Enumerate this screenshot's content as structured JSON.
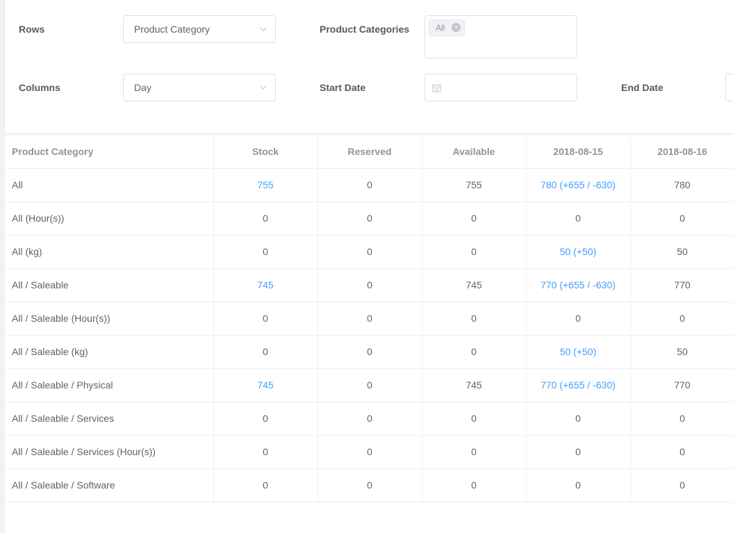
{
  "filters": {
    "rows_label": "Rows",
    "rows_value": "Product Category",
    "columns_label": "Columns",
    "columns_value": "Day",
    "categories_label": "Product Categories",
    "categories_tag": "All",
    "start_date_label": "Start Date",
    "start_date_value": "",
    "end_date_label": "End Date"
  },
  "table": {
    "headers": [
      "Product Category",
      "Stock",
      "Reserved",
      "Available",
      "2018-08-15",
      "2018-08-16"
    ],
    "rows": [
      {
        "cells": [
          "All",
          "755",
          "0",
          "755",
          "780 (+655 / -630)",
          "780"
        ],
        "links": [
          false,
          true,
          false,
          false,
          true,
          false
        ]
      },
      {
        "cells": [
          "All (Hour(s))",
          "0",
          "0",
          "0",
          "0",
          "0"
        ],
        "links": [
          false,
          false,
          false,
          false,
          false,
          false
        ]
      },
      {
        "cells": [
          "All (kg)",
          "0",
          "0",
          "0",
          "50 (+50)",
          "50"
        ],
        "links": [
          false,
          false,
          false,
          false,
          true,
          false
        ]
      },
      {
        "cells": [
          "All / Saleable",
          "745",
          "0",
          "745",
          "770 (+655 / -630)",
          "770"
        ],
        "links": [
          false,
          true,
          false,
          false,
          true,
          false
        ]
      },
      {
        "cells": [
          "All / Saleable (Hour(s))",
          "0",
          "0",
          "0",
          "0",
          "0"
        ],
        "links": [
          false,
          false,
          false,
          false,
          false,
          false
        ]
      },
      {
        "cells": [
          "All / Saleable (kg)",
          "0",
          "0",
          "0",
          "50 (+50)",
          "50"
        ],
        "links": [
          false,
          false,
          false,
          false,
          true,
          false
        ]
      },
      {
        "cells": [
          "All / Saleable / Physical",
          "745",
          "0",
          "745",
          "770 (+655 / -630)",
          "770"
        ],
        "links": [
          false,
          true,
          false,
          false,
          true,
          false
        ]
      },
      {
        "cells": [
          "All / Saleable / Services",
          "0",
          "0",
          "0",
          "0",
          "0"
        ],
        "links": [
          false,
          false,
          false,
          false,
          false,
          false
        ]
      },
      {
        "cells": [
          "All / Saleable / Services (Hour(s))",
          "0",
          "0",
          "0",
          "0",
          "0"
        ],
        "links": [
          false,
          false,
          false,
          false,
          false,
          false
        ]
      },
      {
        "cells": [
          "All / Saleable / Software",
          "0",
          "0",
          "0",
          "0",
          "0"
        ],
        "links": [
          false,
          false,
          false,
          false,
          false,
          false
        ]
      }
    ]
  },
  "colors": {
    "link": "#409eff",
    "header_text": "#909399",
    "body_text": "#606266",
    "border": "#ebeef5"
  },
  "icons": {
    "dropdown": "chevron-down-icon",
    "tag_close": "close-circle-icon",
    "date": "calendar-icon"
  }
}
